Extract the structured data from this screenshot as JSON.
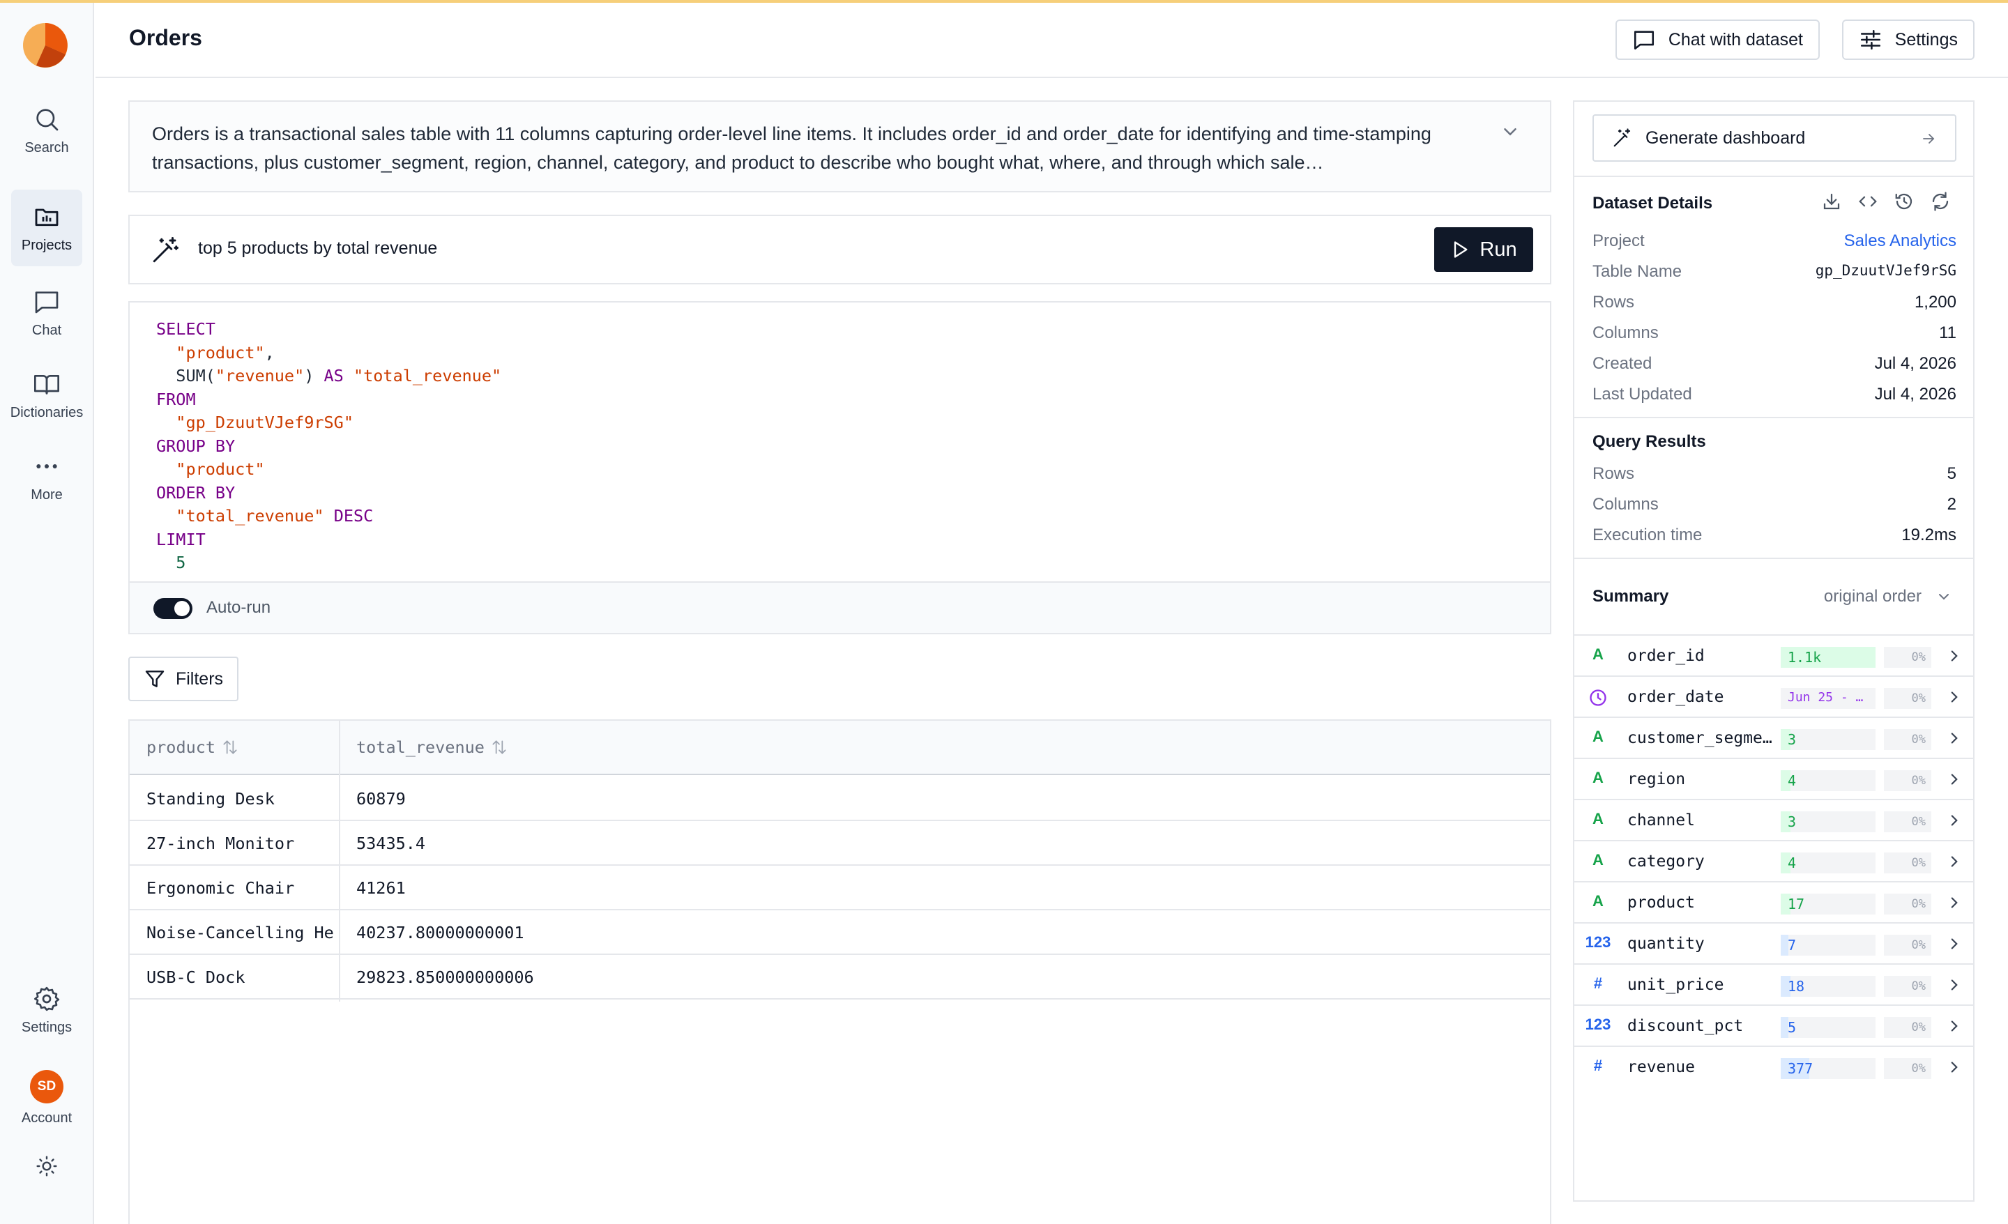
{
  "colors": {
    "accent_top": "#f6cf7a",
    "link": "#2563eb",
    "run_button": "#101828",
    "type_text": "#16a34a",
    "type_number": "#2563eb",
    "type_date": "#9333ea",
    "avatar": "#ea580c"
  },
  "sidebar": {
    "logo": "pie-chart-logo",
    "items": [
      {
        "label": "Search",
        "icon": "search-icon"
      },
      {
        "label": "Projects",
        "icon": "folder-icon",
        "active": true
      },
      {
        "label": "Chat",
        "icon": "chat-icon"
      },
      {
        "label": "Dictionaries",
        "icon": "book-icon"
      },
      {
        "label": "More",
        "icon": "more-icon"
      }
    ],
    "settings_label": "Settings",
    "account_initials": "SD",
    "account_label": "Account",
    "theme_icon": "sun-icon"
  },
  "header": {
    "title": "Orders",
    "chat_button": "Chat with dataset",
    "settings_button": "Settings"
  },
  "description": "Orders is a transactional sales table with 11 columns capturing order-level line items. It includes order_id and order_date for identifying and time-stamping transactions, plus customer_segment, region, channel, category, and product to describe who bought what, where, and through which sale…",
  "query": {
    "prompt": "top 5 products by total revenue",
    "run_label": "Run"
  },
  "sql": {
    "lines": [
      [
        {
          "t": "SELECT",
          "c": "kw"
        }
      ],
      [
        {
          "t": "  "
        },
        {
          "t": "\"product\"",
          "c": "str"
        },
        {
          "t": ","
        }
      ],
      [
        {
          "t": "  SUM("
        },
        {
          "t": "\"revenue\"",
          "c": "str"
        },
        {
          "t": ") "
        },
        {
          "t": "AS",
          "c": "kw"
        },
        {
          "t": " "
        },
        {
          "t": "\"total_revenue\"",
          "c": "str"
        }
      ],
      [
        {
          "t": "FROM",
          "c": "kw"
        }
      ],
      [
        {
          "t": "  "
        },
        {
          "t": "\"gp_DzuutVJef9rSG\"",
          "c": "str"
        }
      ],
      [
        {
          "t": "GROUP BY",
          "c": "kw"
        }
      ],
      [
        {
          "t": "  "
        },
        {
          "t": "\"product\"",
          "c": "str"
        }
      ],
      [
        {
          "t": "ORDER BY",
          "c": "kw"
        }
      ],
      [
        {
          "t": "  "
        },
        {
          "t": "\"total_revenue\"",
          "c": "str"
        },
        {
          "t": " "
        },
        {
          "t": "DESC",
          "c": "kw"
        }
      ],
      [
        {
          "t": "LIMIT",
          "c": "kw"
        }
      ],
      [
        {
          "t": "  "
        },
        {
          "t": "5",
          "c": "num"
        }
      ]
    ],
    "autorun_label": "Auto-run",
    "autorun_on": true
  },
  "filters_label": "Filters",
  "results": {
    "columns": [
      "product",
      "total_revenue"
    ],
    "rows": [
      [
        "Standing Desk",
        "60879"
      ],
      [
        "27-inch Monitor",
        "53435.4"
      ],
      [
        "Ergonomic Chair",
        "41261"
      ],
      [
        "Noise-Cancelling Headphones",
        "40237.80000000001"
      ],
      [
        "USB-C Dock",
        "29823.850000000006"
      ]
    ]
  },
  "right_panel": {
    "generate_label": "Generate dashboard",
    "dataset_details": {
      "title": "Dataset Details",
      "fields": [
        {
          "k": "Project",
          "v": "Sales Analytics",
          "link": true
        },
        {
          "k": "Table Name",
          "v": "gp_DzuutVJef9rSG",
          "mono": true
        },
        {
          "k": "Rows",
          "v": "1,200"
        },
        {
          "k": "Columns",
          "v": "11"
        },
        {
          "k": "Created",
          "v": "Jul 4, 2026"
        },
        {
          "k": "Last Updated",
          "v": "Jul 4, 2026"
        }
      ]
    },
    "query_results": {
      "title": "Query Results",
      "fields": [
        {
          "k": "Rows",
          "v": "5"
        },
        {
          "k": "Columns",
          "v": "2"
        },
        {
          "k": "Execution time",
          "v": "19.2ms"
        }
      ]
    },
    "summary": {
      "title": "Summary",
      "order_label": "original order",
      "columns": [
        {
          "type": "A",
          "kind": "text",
          "name": "order_id",
          "stat": "1.1k",
          "fill_fraction": 1.0,
          "null": "0%"
        },
        {
          "type": "date",
          "kind": "date",
          "name": "order_date",
          "stat": "Jun 25 - …",
          "fill_fraction": 0,
          "null": "0%"
        },
        {
          "type": "A",
          "kind": "text",
          "name": "customer_segment",
          "stat": "3",
          "fill_fraction": 0.1,
          "null": "0%"
        },
        {
          "type": "A",
          "kind": "text",
          "name": "region",
          "stat": "4",
          "fill_fraction": 0.1,
          "null": "0%"
        },
        {
          "type": "A",
          "kind": "text",
          "name": "channel",
          "stat": "3",
          "fill_fraction": 0.1,
          "null": "0%"
        },
        {
          "type": "A",
          "kind": "text",
          "name": "category",
          "stat": "4",
          "fill_fraction": 0.1,
          "null": "0%"
        },
        {
          "type": "A",
          "kind": "text",
          "name": "product",
          "stat": "17",
          "fill_fraction": 0.1,
          "null": "0%"
        },
        {
          "type": "123",
          "kind": "int",
          "name": "quantity",
          "stat": "7",
          "fill_fraction": 0.08,
          "null": "0%"
        },
        {
          "type": "#",
          "kind": "float",
          "name": "unit_price",
          "stat": "18",
          "fill_fraction": 0.1,
          "null": "0%"
        },
        {
          "type": "123",
          "kind": "int",
          "name": "discount_pct",
          "stat": "5",
          "fill_fraction": 0.08,
          "null": "0%"
        },
        {
          "type": "#",
          "kind": "float",
          "name": "revenue",
          "stat": "377",
          "fill_fraction": 0.3,
          "null": "0%"
        }
      ]
    }
  }
}
